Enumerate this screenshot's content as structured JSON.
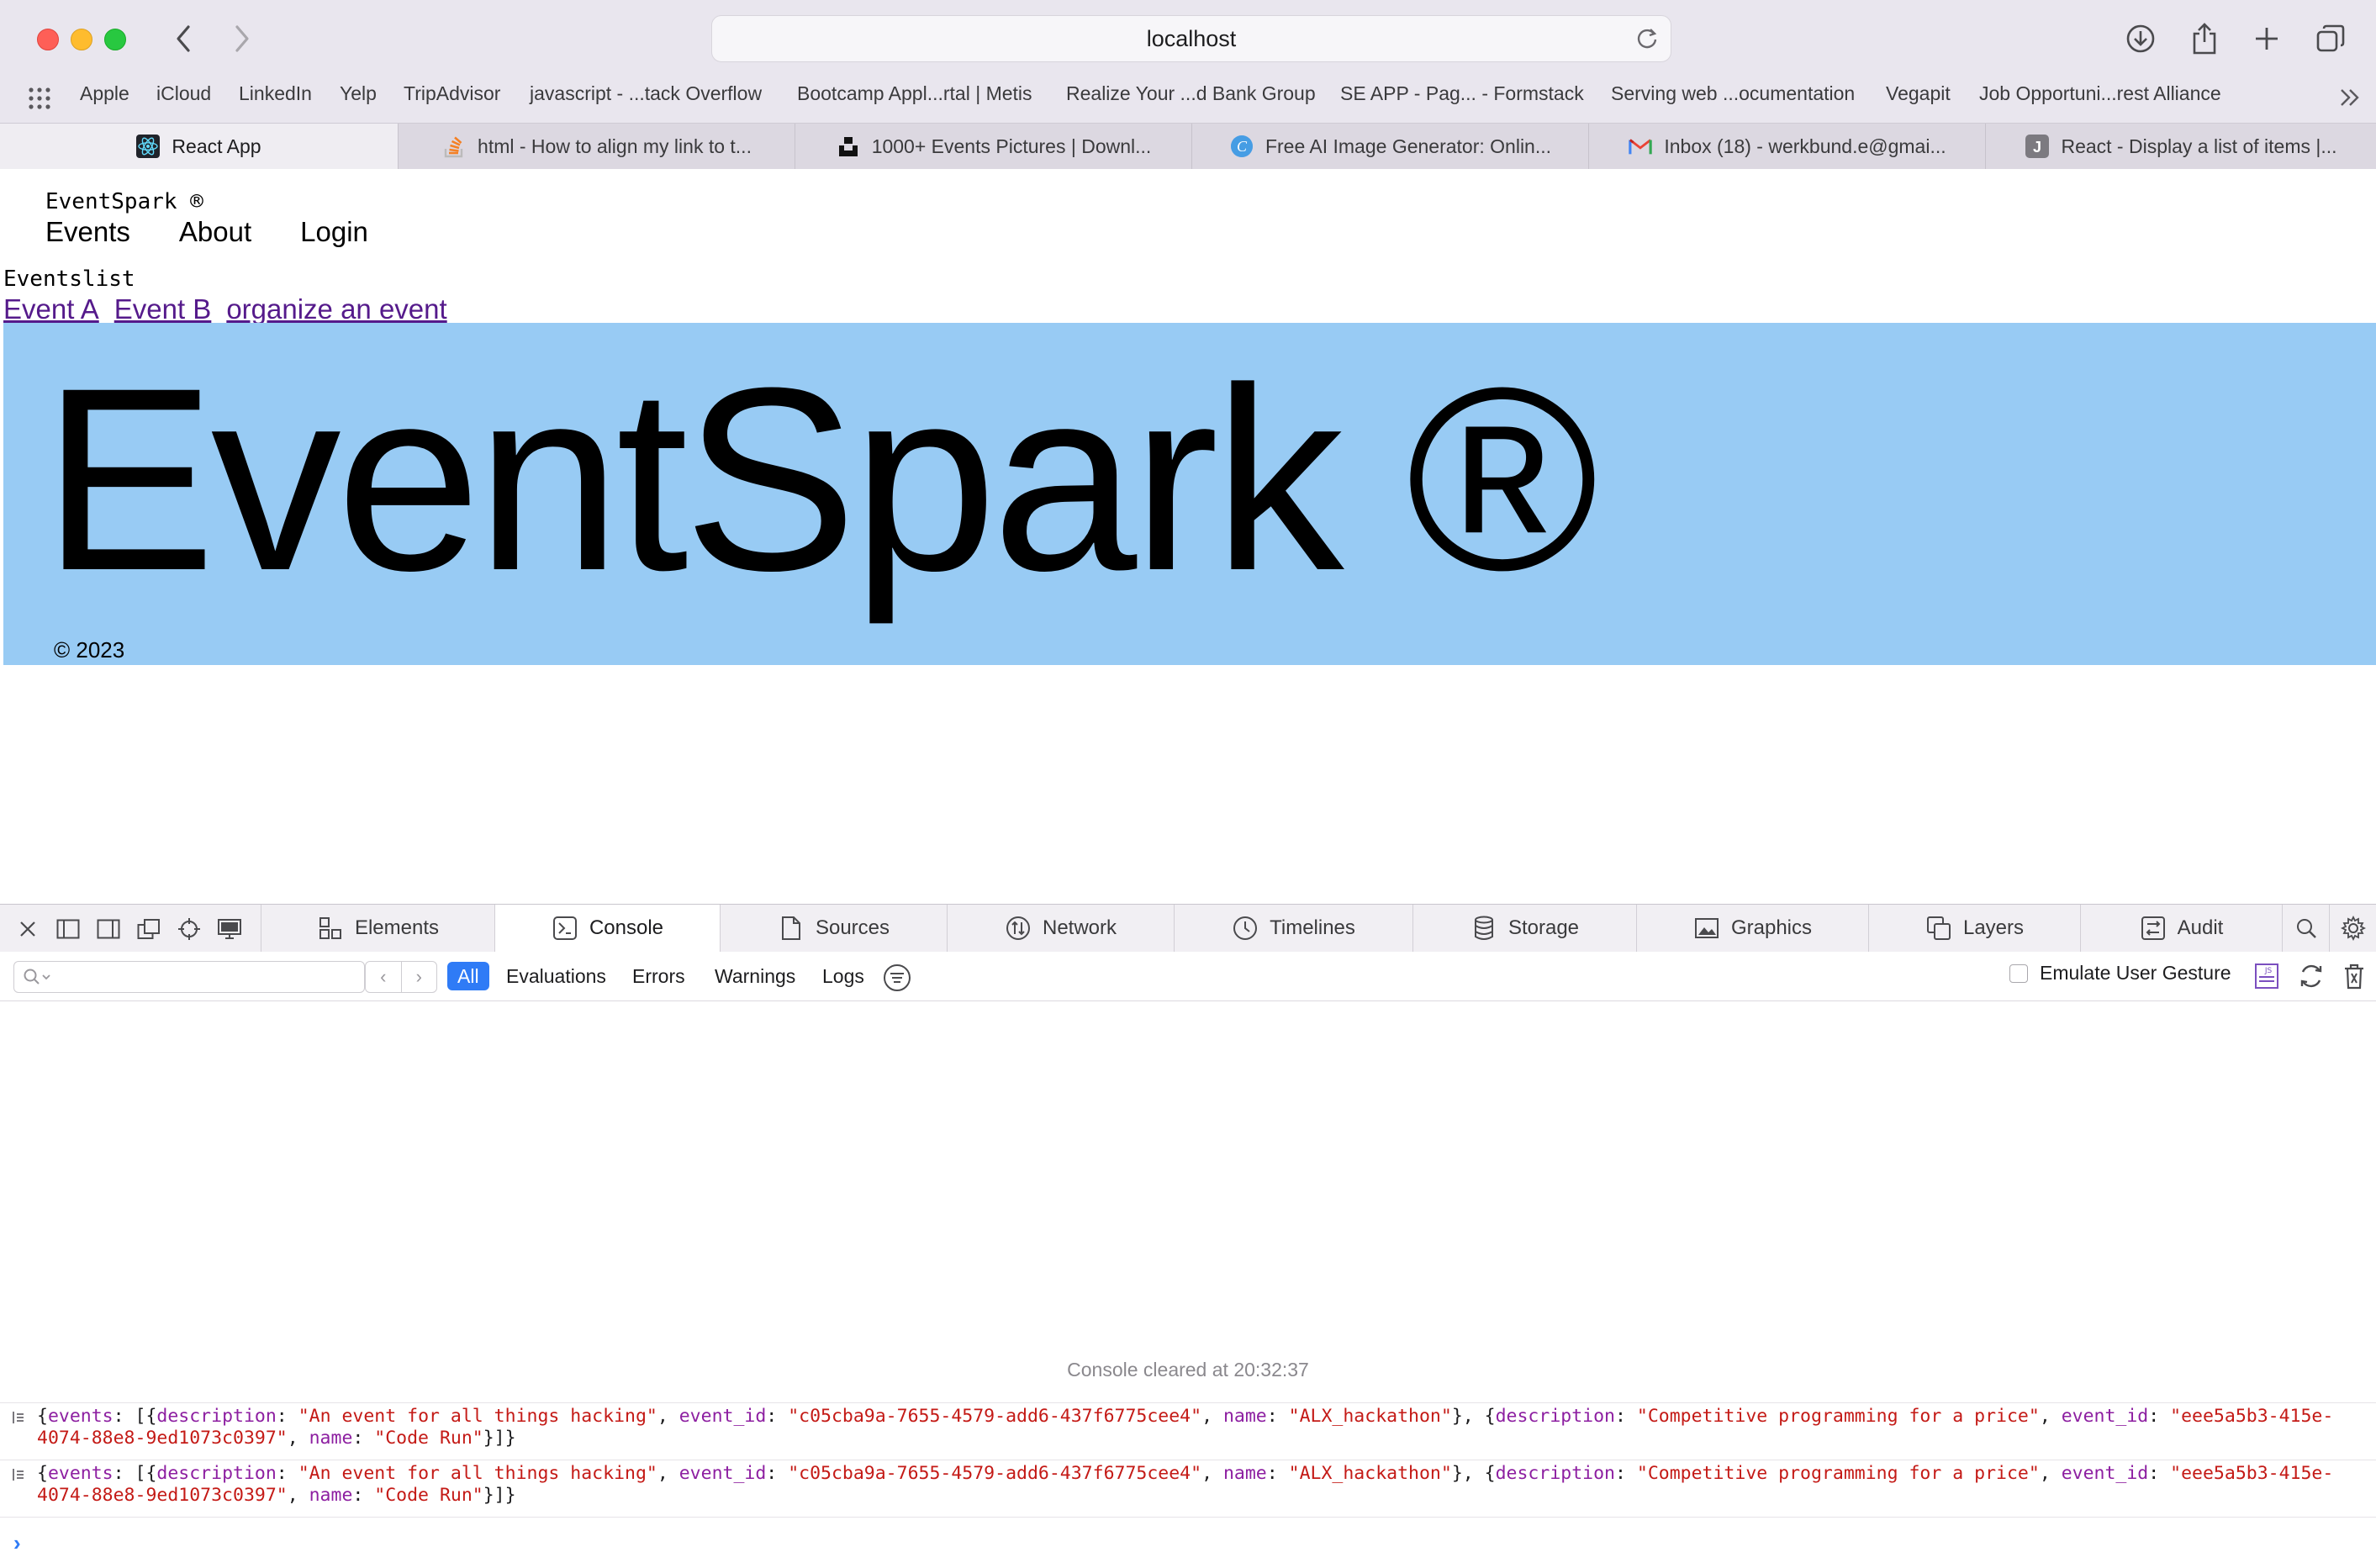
{
  "browser": {
    "url": "localhost",
    "bookmarks": [
      "Apple",
      "iCloud",
      "LinkedIn",
      "Yelp",
      "TripAdvisor",
      "javascript - ...tack Overflow",
      "Bootcamp Appl...rtal | Metis",
      "Realize Your ...d Bank Group",
      "SE APP - Pag... - Formstack",
      "Serving web ...ocumentation",
      "Vegapit",
      "Job Opportuni...rest Alliance"
    ],
    "tabs": [
      {
        "label": "React App",
        "icon": "react-icon"
      },
      {
        "label": "html - How to align my link to t...",
        "icon": "stackoverflow-icon"
      },
      {
        "label": "1000+ Events Pictures | Downl...",
        "icon": "unsplash-icon"
      },
      {
        "label": "Free AI Image Generator: Onlin...",
        "icon": "canva-icon"
      },
      {
        "label": "Inbox (18) - werkbund.e@gmai...",
        "icon": "gmail-icon"
      },
      {
        "label": "React - Display a list of items |...",
        "icon": "j-icon"
      }
    ]
  },
  "page": {
    "brand_small": "EventSpark ®",
    "menu": [
      "Events",
      "About",
      "Login"
    ],
    "list_label": "Eventslist",
    "links": [
      "Event A",
      "Event B",
      "organize an event"
    ],
    "hero_title": "EventSpark ®",
    "copyright": "© 2023",
    "hero_bg": "#98cbf4",
    "link_color": "#551a8b"
  },
  "devtools": {
    "tabs": [
      "Elements",
      "Console",
      "Sources",
      "Network",
      "Timelines",
      "Storage",
      "Graphics",
      "Layers",
      "Audit"
    ],
    "active_tab": "Console",
    "filters": [
      "All",
      "Evaluations",
      "Errors",
      "Warnings",
      "Logs"
    ],
    "emulate_label": "Emulate User Gesture",
    "cleared": "Console cleared at 20:32:37",
    "logs": [
      {
        "events_key": "events",
        "desc1": "\"An event for all things hacking\"",
        "id1": "\"c05cba9a-7655-4579-add6-437f6775cee4\"",
        "name1": "\"ALX_hackathon\"",
        "desc2": "\"Competitive programming for a price\"",
        "id2": "\"eee5a5b3-415e-4074-88e8-9ed1073c0397\"",
        "name2": "\"Code Run\""
      },
      {
        "events_key": "events",
        "desc1": "\"An event for all things hacking\"",
        "id1": "\"c05cba9a-7655-4579-add6-437f6775cee4\"",
        "name1": "\"ALX_hackathon\"",
        "desc2": "\"Competitive programming for a price\"",
        "id2": "\"eee5a5b3-415e-4074-88e8-9ed1073c0397\"",
        "name2": "\"Code Run\""
      }
    ],
    "accent": "#2f7bf6"
  }
}
